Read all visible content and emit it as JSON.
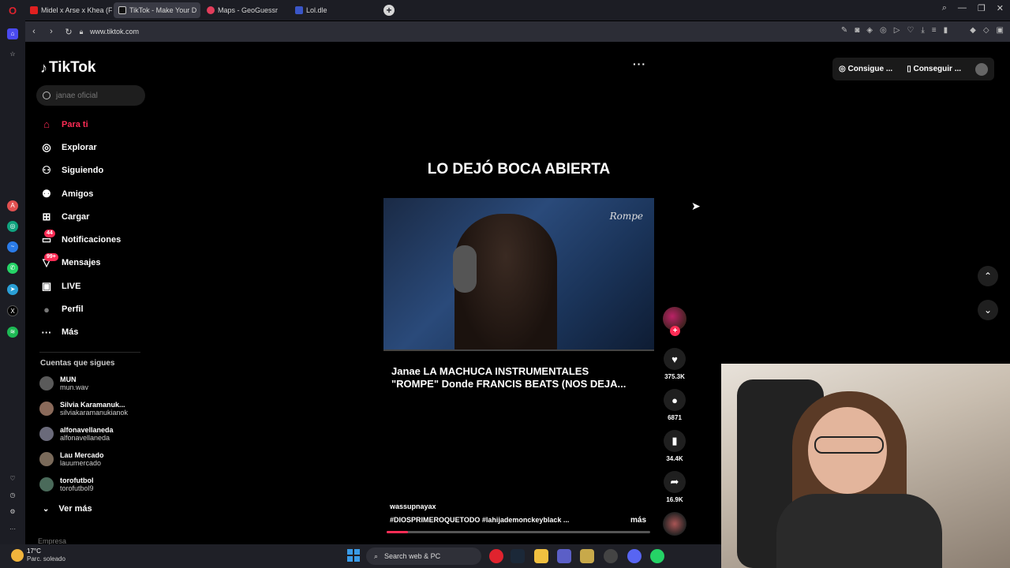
{
  "browser": {
    "tabs": [
      {
        "title": "Midel x Arse x Khea (Ft. D",
        "color": "#e02020"
      },
      {
        "title": "TikTok - Make Your D",
        "color": "#ffffff",
        "active": true
      },
      {
        "title": "Maps - GeoGuessr",
        "color": "#e23d5b"
      },
      {
        "title": "Lol.dle",
        "color": "#3a56c8"
      }
    ],
    "url": "www.tiktok.com"
  },
  "tiktok": {
    "logo": "TikTok",
    "search_placeholder": "janae oficial",
    "nav": [
      {
        "label": "Para ti",
        "icon": "home-icon",
        "glyph": "⌂",
        "active": true
      },
      {
        "label": "Explorar",
        "icon": "compass-icon",
        "glyph": "◎"
      },
      {
        "label": "Siguiendo",
        "icon": "following-icon",
        "glyph": "⚇"
      },
      {
        "label": "Amigos",
        "icon": "friends-icon",
        "glyph": "⚉"
      },
      {
        "label": "Cargar",
        "icon": "upload-icon",
        "glyph": "⊞"
      },
      {
        "label": "Notificaciones",
        "icon": "inbox-icon",
        "glyph": "▭",
        "badge": "44"
      },
      {
        "label": "Mensajes",
        "icon": "messages-icon",
        "glyph": "▽",
        "badge": "99+"
      },
      {
        "label": "LIVE",
        "icon": "live-icon",
        "glyph": "▣"
      },
      {
        "label": "Perfil",
        "icon": "profile-icon",
        "glyph": "●"
      },
      {
        "label": "Más",
        "icon": "more-icon",
        "glyph": "···"
      }
    ],
    "following_title": "Cuentas que sigues",
    "following": [
      {
        "name": "MUN",
        "handle": "mun.wav"
      },
      {
        "name": "Silvia Karamanuk...",
        "handle": "silviakaramanukianok"
      },
      {
        "name": "alfonavellaneda",
        "handle": "alfonavellaneda"
      },
      {
        "name": "Lau Mercado",
        "handle": "lauumercado"
      },
      {
        "name": "torofutbol",
        "handle": "torofutbol9"
      }
    ],
    "ver_mas": "Ver más",
    "empresa": "Empresa",
    "top_right": {
      "get_coins": "Consigue ...",
      "get_app": "Conseguir ..."
    },
    "video": {
      "title": "LO DEJÓ BOCA ABIERTA",
      "watermark": "Rompe",
      "caption": "Janae LA MACHUCA INSTRUMENTALES\n\"ROMPE\" Donde FRANCIS BEATS (NOS DEJA...",
      "author": "wassupnayax",
      "tags": "#DIOSPRIMEROQUETODO  #lahijademonckeyblack  ...",
      "more": "más",
      "progress": 0.08
    },
    "actions": {
      "likes": "375.3K",
      "comments": "6871",
      "saves": "34.4K",
      "shares": "16.9K"
    }
  },
  "taskbar": {
    "temp": "17°C",
    "weather": "Parc. soleado",
    "search": "Search web & PC"
  }
}
